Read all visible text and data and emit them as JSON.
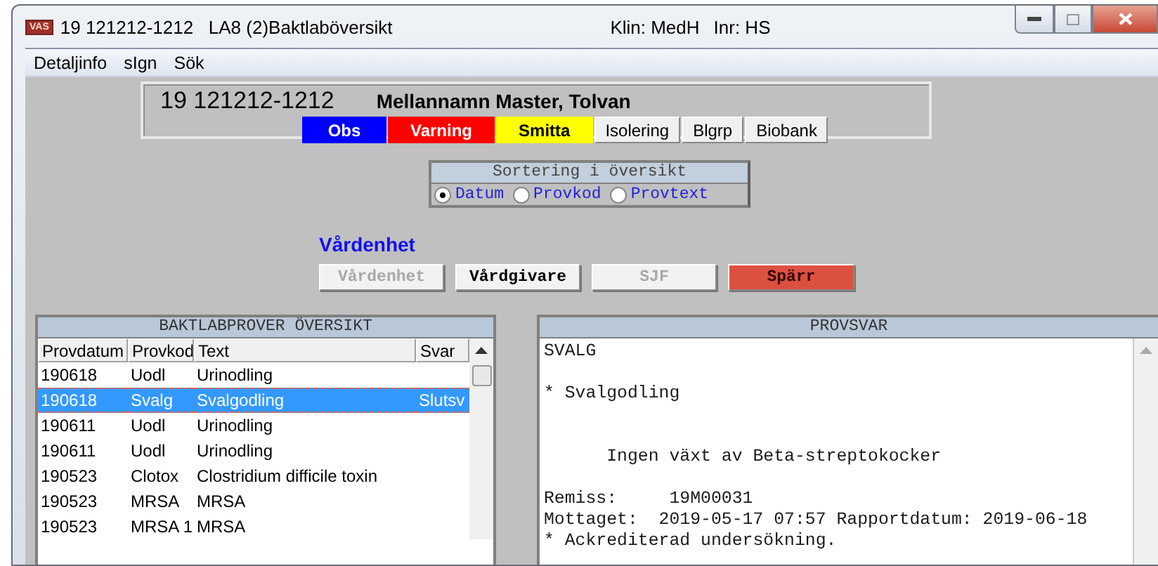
{
  "window": {
    "badge": "VAS",
    "title": "19 121212-1212   LA8 (2)Baktlaböversikt",
    "clinic": "Klin: MedH",
    "unit": "Inr: HS"
  },
  "menu": [
    "Detaljinfo",
    "sIgn",
    "Sök"
  ],
  "patient": {
    "id": "19 121212-1212",
    "name": "Mellannamn Master, Tolvan",
    "flags": [
      {
        "label": "Obs",
        "kind": "blue"
      },
      {
        "label": "Varning",
        "kind": "red"
      },
      {
        "label": "Smitta",
        "kind": "yellow"
      },
      {
        "label": "Isolering",
        "kind": "plain"
      },
      {
        "label": "Blgrp",
        "kind": "plain"
      },
      {
        "label": "Biobank",
        "kind": "plain"
      }
    ]
  },
  "sorting": {
    "title": "Sortering i översikt",
    "options": [
      {
        "label": "Datum",
        "selected": true
      },
      {
        "label": "Provkod",
        "selected": false
      },
      {
        "label": "Provtext",
        "selected": false
      }
    ]
  },
  "care": {
    "heading": "Vårdenhet",
    "buttons": [
      {
        "label": "Vårdenhet",
        "disabled": true,
        "kind": "normal"
      },
      {
        "label": "Vårdgivare",
        "disabled": false,
        "kind": "normal"
      },
      {
        "label": "SJF",
        "disabled": true,
        "kind": "normal"
      },
      {
        "label": "Spärr",
        "disabled": false,
        "kind": "alert"
      }
    ]
  },
  "overview": {
    "title": "BAKTLABPROVER ÖVERSIKT",
    "columns": [
      "Provdatum",
      "Provkod",
      "Text",
      "Svar"
    ],
    "rows": [
      {
        "cells": [
          "190618",
          "Uodl",
          "Urinodling",
          ""
        ],
        "selected": false
      },
      {
        "cells": [
          "190618",
          "Svalg",
          "Svalgodling",
          "Slutsv"
        ],
        "selected": true
      },
      {
        "cells": [
          "190611",
          "Uodl",
          "Urinodling",
          ""
        ],
        "selected": false
      },
      {
        "cells": [
          "190611",
          "Uodl",
          "Urinodling",
          ""
        ],
        "selected": false
      },
      {
        "cells": [
          "190523",
          "Clotox",
          "Clostridium difficile toxin",
          ""
        ],
        "selected": false
      },
      {
        "cells": [
          "190523",
          "MRSA",
          "MRSA",
          ""
        ],
        "selected": false
      },
      {
        "cells": [
          "190523",
          "MRSA 1",
          "MRSA",
          ""
        ],
        "selected": false
      }
    ]
  },
  "result": {
    "title": "PROVSVAR",
    "text": "SVALG\n\n* Svalgodling\n\n\n      Ingen växt av Beta-streptokocker\n\nRemiss:     19M00031\nMottaget:  2019-05-17 07:57 Rapportdatum: 2019-06-18\n* Ackrediterad undersökning."
  }
}
